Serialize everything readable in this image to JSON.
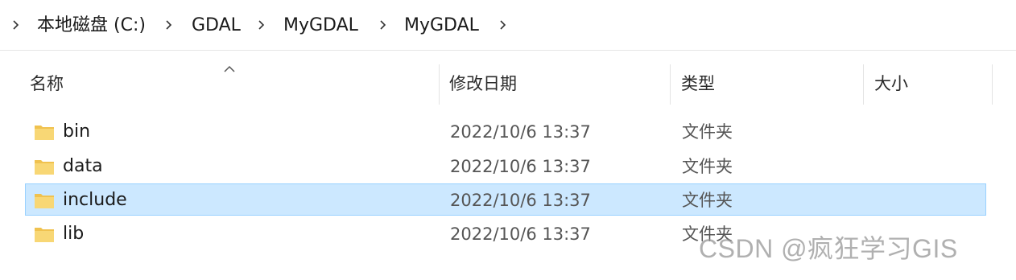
{
  "breadcrumb": {
    "items": [
      {
        "label": "本地磁盘 (C:)"
      },
      {
        "label": "GDAL"
      },
      {
        "label": "MyGDAL"
      },
      {
        "label": "MyGDAL"
      }
    ]
  },
  "columns": {
    "name": "名称",
    "modified": "修改日期",
    "type": "类型",
    "size": "大小"
  },
  "files": [
    {
      "name": "bin",
      "modified": "2022/10/6 13:37",
      "type": "文件夹",
      "size": "",
      "selected": false,
      "icon": "folder-icon"
    },
    {
      "name": "data",
      "modified": "2022/10/6 13:37",
      "type": "文件夹",
      "size": "",
      "selected": false,
      "icon": "folder-icon"
    },
    {
      "name": "include",
      "modified": "2022/10/6 13:37",
      "type": "文件夹",
      "size": "",
      "selected": true,
      "icon": "folder-icon"
    },
    {
      "name": "lib",
      "modified": "2022/10/6 13:37",
      "type": "文件夹",
      "size": "",
      "selected": false,
      "icon": "folder-icon"
    }
  ],
  "watermark": "CSDN @疯狂学习GIS",
  "colors": {
    "selection_bg": "#cce8ff",
    "selection_border": "#99d1ff",
    "folder_yellow": "#f8d775"
  }
}
